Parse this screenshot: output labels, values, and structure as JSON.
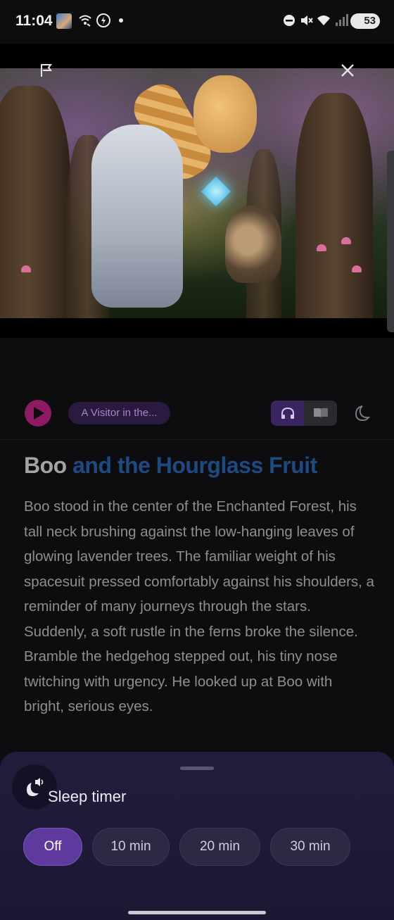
{
  "status_bar": {
    "time": "11:04",
    "battery": "53",
    "icons": [
      "avatar-icon",
      "wifi-calling-icon",
      "power-saving-icon",
      "dot-icon",
      "do-not-disturb-icon",
      "mute-icon",
      "wifi-icon",
      "signal-icon",
      "battery-icon"
    ]
  },
  "hero": {
    "flag_icon": "flag-icon",
    "close_icon": "close-icon"
  },
  "controls": {
    "play_icon": "play-icon",
    "chapter_label": "A Visitor in the...",
    "modes": [
      "headphones-icon",
      "book-icon"
    ],
    "active_mode": "headphones",
    "sleep_icon": "moon-icon"
  },
  "story": {
    "title_part1": "Boo",
    "title_part2": " and the Hourglass Fruit",
    "body": "Boo stood in the center of the Enchanted Forest, his tall neck brushing against the low-hanging leaves of glowing lavender trees. The familiar weight of his spacesuit pressed comfortably against his shoulders, a reminder of many journeys through the stars. Suddenly, a soft rustle in the ferns broke the silence. Bramble the hedgehog stepped out, his tiny nose twitching with urgency. He looked up at Boo with bright, serious eyes."
  },
  "sleep_sheet": {
    "title": "Sleep timer",
    "icon": "sleep-timer-icon",
    "options": [
      "Off",
      "10 min",
      "20 min",
      "30 min"
    ],
    "selected": "Off"
  },
  "colors": {
    "background": "#0d0d0f",
    "accent_play": "#8e1a63",
    "accent_selected": "#5e3a9e",
    "title_highlight": "#1e4a82",
    "sheet": "#221d3c"
  }
}
